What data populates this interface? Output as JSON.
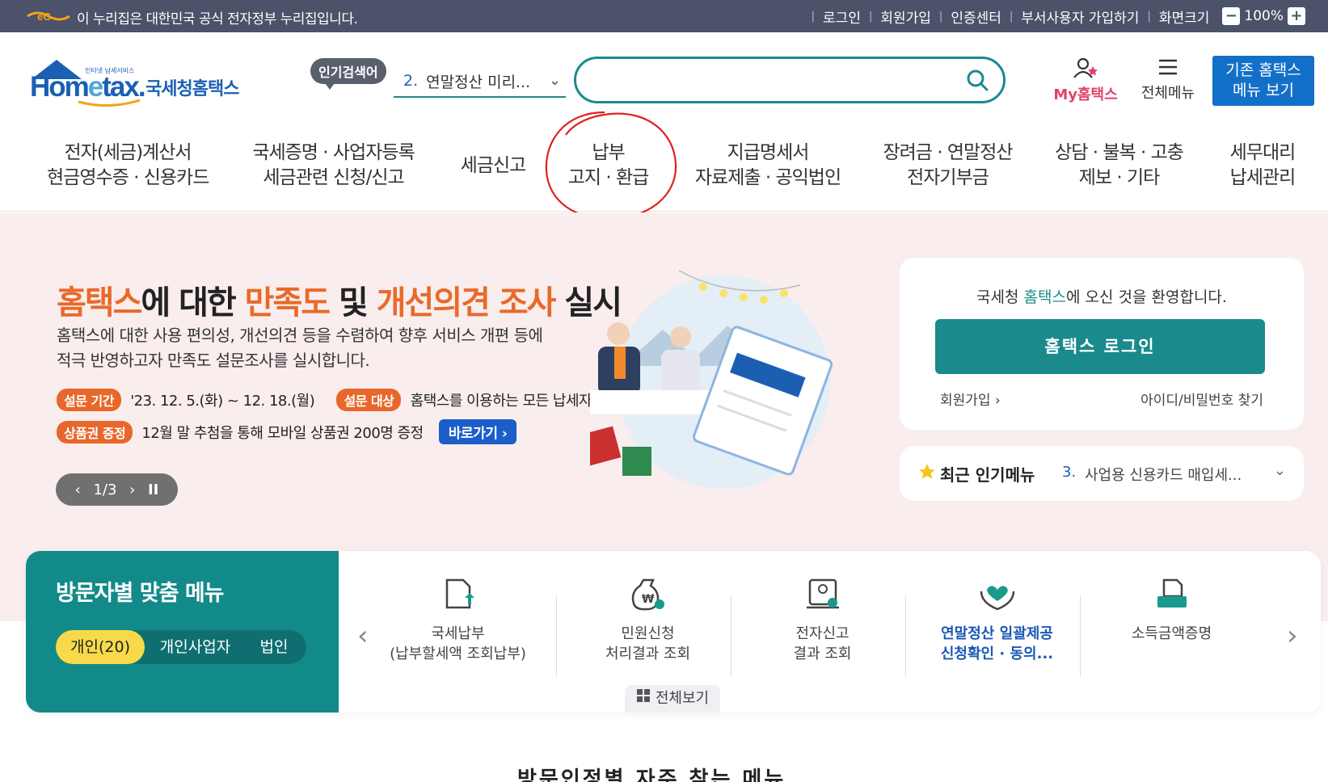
{
  "govbar": {
    "notice": "이 누리집은 대한민국 공식 전자정부 누리집입니다.",
    "links": [
      "로그인",
      "회원가입",
      "인증센터",
      "부서사용자 가입하기",
      "화면크기"
    ],
    "zoom_minus": "−",
    "zoom": "100%",
    "zoom_plus": "+"
  },
  "header": {
    "logo_small": "인터넷 납세서비스",
    "logo_brand_a": "Hom",
    "logo_brand_e": "e",
    "logo_brand_b": "tax.",
    "logo_kor": "국세청홈택스",
    "hot_label": "인기검색어",
    "hot_num": "2.",
    "hot_value": "연말정산 미리...",
    "search_value": "",
    "my_label": "My홈택스",
    "all_menu": "전체메뉴",
    "old_menu_1": "기존 홈택스",
    "old_menu_2": "메뉴 보기"
  },
  "gnb": [
    {
      "l1": "전자(세금)계산서",
      "l2": "현금영수증 · 신용카드"
    },
    {
      "l1": "국세증명 · 사업자등록",
      "l2": "세금관련 신청/신고"
    },
    {
      "l1": "세금신고",
      "l2": ""
    },
    {
      "l1": "납부",
      "l2": "고지 · 환급"
    },
    {
      "l1": "지급명세서",
      "l2": "자료제출 · 공익법인"
    },
    {
      "l1": "장려금 · 연말정산",
      "l2": "전자기부금"
    },
    {
      "l1": "상담 · 불복 · 고충",
      "l2": "제보 · 기타"
    },
    {
      "l1": "세무대리",
      "l2": "납세관리"
    }
  ],
  "hero": {
    "t1": "홈택스",
    "t2": "에 대한 ",
    "t3": "만족도",
    "t4": " 및 ",
    "t5": "개선의견 조사",
    "t6": " 실시",
    "desc1": "홈택스에 대한 사용 편의성, 개선의견 등을 수렴하여 향후 서비스 개편 등에",
    "desc2": "적극 반영하고자 만족도 설문조사를 실시합니다.",
    "period_label": "설문 기간",
    "period_value": "'23. 12. 5.(화) ~ 12. 18.(월)",
    "target_label": "설문 대상",
    "target_value": "홈택스를 이용하는 모든 납세자",
    "gift_label": "상품권 증정",
    "gift_value": "12월 말 추첨을 통해 모바일 상품권 200명 증정",
    "go_label": "바로가기 ›",
    "page": "1/3"
  },
  "login": {
    "welcome_a": "국세청 ",
    "welcome_hl": "홈택스",
    "welcome_b": "에 오신 것을 환영합니다.",
    "button": "홈택스 로그인",
    "join": "회원가입 ›",
    "find": "아이디/비밀번호 찾기"
  },
  "popular": {
    "label": "최근 인기메뉴",
    "num": "3.",
    "value": "사업용 신용카드 매입세..."
  },
  "visitor": {
    "title": "방문자별 맞춤 메뉴",
    "tabs": [
      "개인(20)",
      "개인사업자",
      "법인"
    ],
    "items": [
      {
        "l1": "국세납부",
        "l2": "(납부할세액 조회납부)"
      },
      {
        "l1": "민원신청",
        "l2": "처리결과 조회"
      },
      {
        "l1": "전자신고",
        "l2": "결과 조회"
      },
      {
        "l1": "연말정산 일괄제공",
        "l2": "신청확인 · 동의..."
      },
      {
        "l1": "소득금액증명",
        "l2": ""
      }
    ],
    "view_all": "전체보기"
  },
  "bottom_title": "방문인정별 자주 찾는 메뉴",
  "colors": {
    "teal": "#1a8a8c",
    "orange": "#e86a2a",
    "blue": "#1b5fb3",
    "govbar": "#4b5269"
  }
}
